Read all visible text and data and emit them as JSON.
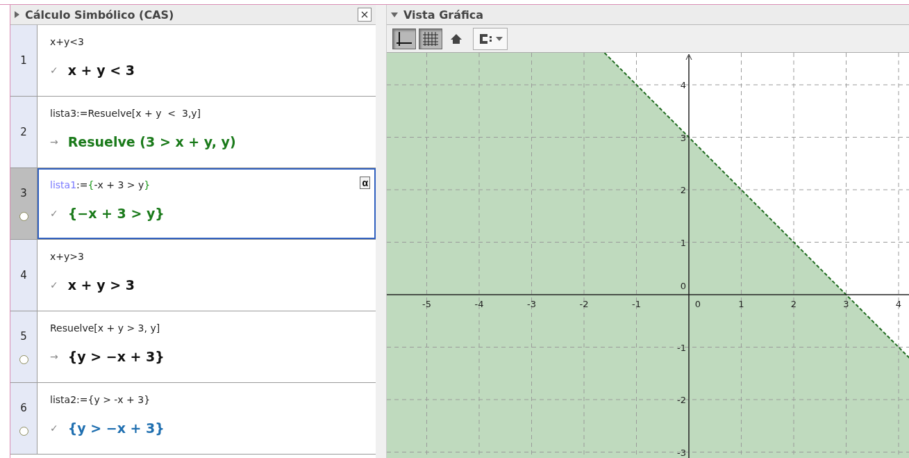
{
  "cas_panel": {
    "title": "Cálculo Simbólico (CAS)",
    "rows": [
      {
        "number": "1",
        "selected": false,
        "has_toggle": false,
        "input": [
          {
            "text": "x+y<3",
            "kind": "plain"
          }
        ],
        "marker": "✓",
        "output": "x + y < 3",
        "color": "#111111"
      },
      {
        "number": "2",
        "selected": false,
        "has_toggle": false,
        "input": [
          {
            "text": "lista3:=Resuelve[x + y  <  3,y]",
            "kind": "plain"
          }
        ],
        "marker": "→",
        "output": "Resuelve (3 > x + y, y)",
        "color": "#1a7a1a"
      },
      {
        "number": "3",
        "selected": true,
        "has_toggle": true,
        "input": [
          {
            "text": "lista1",
            "kind": "name"
          },
          {
            "text": ":=",
            "kind": "plain"
          },
          {
            "text": "{",
            "kind": "brace"
          },
          {
            "text": "-x + 3 > y",
            "kind": "plain"
          },
          {
            "text": "}",
            "kind": "brace"
          }
        ],
        "marker": "✓",
        "output": "{−x + 3 > y}",
        "color": "#1a7a1a",
        "action": "α"
      },
      {
        "number": "4",
        "selected": false,
        "has_toggle": false,
        "input": [
          {
            "text": "x+y>3",
            "kind": "plain"
          }
        ],
        "marker": "✓",
        "output": "x + y > 3",
        "color": "#111111"
      },
      {
        "number": "5",
        "selected": false,
        "has_toggle": true,
        "input": [
          {
            "text": "Resuelve[x + y > 3, y]",
            "kind": "plain"
          }
        ],
        "marker": "→",
        "output": "{y > −x + 3}",
        "color": "#111111"
      },
      {
        "number": "6",
        "selected": false,
        "has_toggle": true,
        "input": [
          {
            "text": "lista2:={y > -x + 3}",
            "kind": "plain"
          }
        ],
        "marker": "✓",
        "output": "{y > −x + 3}",
        "color": "#1f6fb0"
      }
    ]
  },
  "graphics_panel": {
    "title": "Vista Gráfica",
    "toolbar": [
      {
        "kind": "axes",
        "selected": true
      },
      {
        "kind": "grid",
        "selected": true
      },
      {
        "kind": "home"
      },
      {
        "kind": "point-capture"
      }
    ],
    "x_tick_labels": [
      "-5",
      "-4",
      "-3",
      "-2",
      "-1",
      "0",
      "1",
      "2",
      "3",
      "4"
    ],
    "y_tick_labels": [
      "4",
      "3",
      "2",
      "1",
      "0",
      "-1",
      "-2",
      "-3"
    ]
  }
}
